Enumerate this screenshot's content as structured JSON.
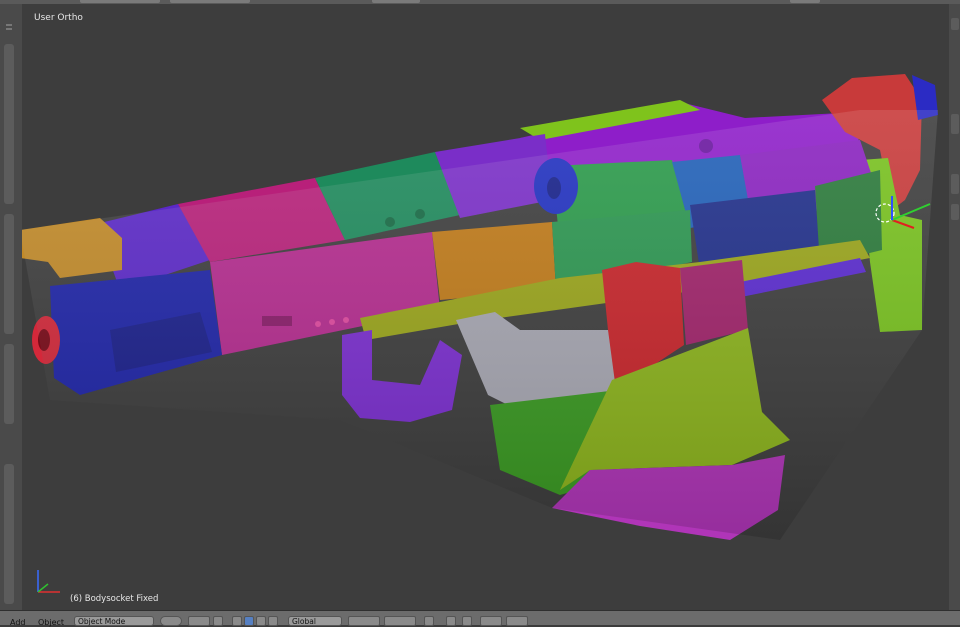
{
  "viewport": {
    "view_label": "User Ortho",
    "object_label": "(6) Bodysocket Fixed"
  },
  "bottom_bar": {
    "menu_add": "Add",
    "menu_object": "Object",
    "mode_select": "Object Mode",
    "orientation_select": "Global"
  },
  "icons": {
    "axis_gizmo": "axis-icon",
    "viewport_shading": "shading-icon",
    "pivot": "pivot-icon",
    "manipulator": "manipulator-icon",
    "layers": "layers-icon",
    "lock": "lock-icon",
    "snap": "snap-icon",
    "render": "render-icon"
  },
  "colors": {
    "viewport_bg": "#3d3d3d",
    "toolbar_bg": "#6c6c6c",
    "active_icon": "#5680c2"
  }
}
